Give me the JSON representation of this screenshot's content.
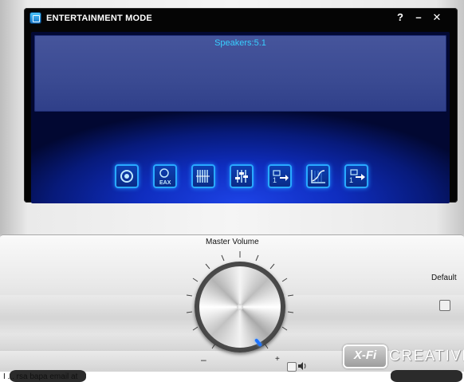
{
  "window": {
    "title": "ENTERTAINMENT MODE",
    "help_label": "?",
    "minimize_label": "–",
    "close_label": "✕"
  },
  "display": {
    "status_text": "Speakers:5.1"
  },
  "mode_buttons": [
    {
      "icon": "speaker-icon"
    },
    {
      "icon": "eax-icon",
      "label": "EAX"
    },
    {
      "icon": "equalizer-bars-icon"
    },
    {
      "icon": "mixer-sliders-icon"
    },
    {
      "icon": "audio-routing-icon"
    },
    {
      "icon": "graph-icon"
    },
    {
      "icon": "audio-output-icon"
    }
  ],
  "volume": {
    "label": "Master Volume",
    "min_label": "–",
    "max_label": "+",
    "level": 0.85
  },
  "default": {
    "label": "Default"
  },
  "branding": {
    "xfi": "X-Fi",
    "creative": "CREATIVE"
  },
  "background_page": {
    "text": "I ... rsa bapa email at"
  },
  "colors": {
    "panel_bg": "#050505",
    "display_blue": "#0f2dbf",
    "accent_cyan": "#38cfff",
    "button_border": "#29a9ff"
  }
}
